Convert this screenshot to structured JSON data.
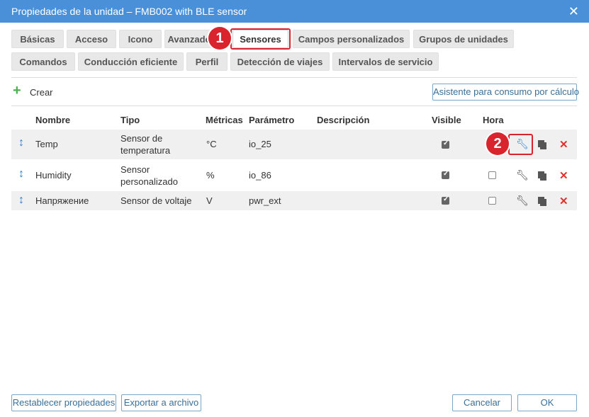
{
  "window": {
    "title": "Propiedades de la unidad – FMB002 with BLE sensor",
    "close_glyph": "✕"
  },
  "tabs": [
    {
      "label": "Básicas"
    },
    {
      "label": "Acceso"
    },
    {
      "label": "Icono"
    },
    {
      "label": "Avanzado"
    },
    {
      "label": "Sensores",
      "active": true
    },
    {
      "label": "Campos personalizados"
    },
    {
      "label": "Grupos de unidades"
    },
    {
      "label": "Comandos"
    },
    {
      "label": "Conducción eficiente"
    },
    {
      "label": "Perfil"
    },
    {
      "label": "Detección de viajes"
    },
    {
      "label": "Intervalos de servicio"
    }
  ],
  "annotations": {
    "step1": "1",
    "step2": "2",
    "color": "#d9232d"
  },
  "toolbar": {
    "create_label": "Crear",
    "wizard_label": "Asistente para consumo por cálculo"
  },
  "table": {
    "headers": {
      "name": "Nombre",
      "type": "Tipo",
      "metrics": "Métricas",
      "param": "Parámetro",
      "desc": "Descripción",
      "visible": "Visible",
      "hour": "Hora"
    },
    "rows": [
      {
        "name": "Temp",
        "type": "Sensor de temperatura",
        "metrics": "°C",
        "param": "io_25",
        "desc": "",
        "visible": true,
        "hour": false
      },
      {
        "name": "Humidity",
        "type": "Sensor personalizado",
        "metrics": "%",
        "param": "io_86",
        "desc": "",
        "visible": true,
        "hour": false
      },
      {
        "name": "Напряжение",
        "type": "Sensor de voltaje",
        "metrics": "V",
        "param": "pwr_ext",
        "desc": "",
        "visible": true,
        "hour": false
      }
    ]
  },
  "icons": {
    "drag": "↕",
    "edit": "wrench-icon",
    "copy": "copy-icon",
    "delete": "✕",
    "create": "+"
  },
  "footer": {
    "reset_label": "Restablecer propiedades",
    "export_label": "Exportar a archivo",
    "cancel_label": "Cancelar",
    "ok_label": "OK"
  }
}
